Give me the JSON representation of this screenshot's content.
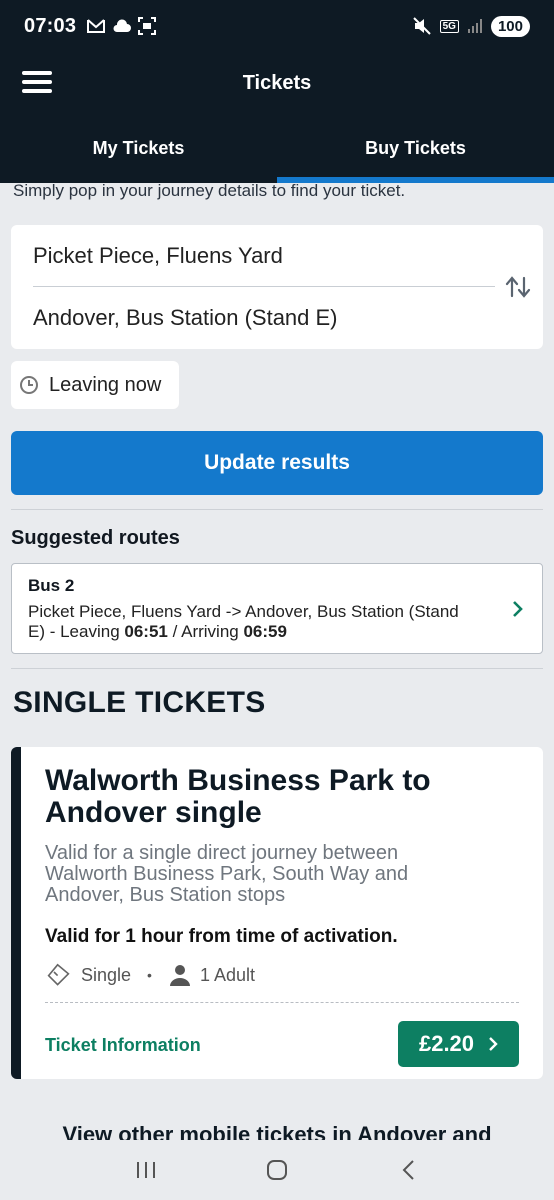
{
  "status_bar": {
    "time": "07:03",
    "network": "5G",
    "battery": "100"
  },
  "app_bar": {
    "title": "Tickets"
  },
  "tabs": [
    {
      "label": "My Tickets",
      "active": false
    },
    {
      "label": "Buy Tickets",
      "active": true
    }
  ],
  "journey": {
    "intro": "Simply pop in your journey details to find your ticket.",
    "from": "Picket Piece, Fluens Yard",
    "to": "Andover, Bus Station (Stand E)",
    "leaving": "Leaving now",
    "update_label": "Update results"
  },
  "suggested": {
    "title": "Suggested routes",
    "route": {
      "bus": "Bus 2",
      "desc_prefix": "Picket Piece, Fluens Yard -> Andover, Bus Station (Stand E) - Leaving ",
      "leave_time": "06:51",
      "sep": " / Arriving ",
      "arrive_time": "06:59"
    }
  },
  "single_tickets": {
    "section_title": "SINGLE TICKETS",
    "ticket": {
      "name": "Walworth Business Park to Andover single",
      "valid_text": "Valid for a single direct journey between Walworth Business Park, South Way and Andover, Bus Station stops",
      "duration": "Valid for 1 hour from time of activation.",
      "type": "Single",
      "passengers": "1 Adult",
      "info_label": "Ticket Information",
      "price": "£2.20"
    }
  },
  "more_link": "View other mobile tickets in Andover and",
  "colors": {
    "navy": "#0e1a24",
    "blue": "#1479cc",
    "green": "#0d7f62"
  }
}
